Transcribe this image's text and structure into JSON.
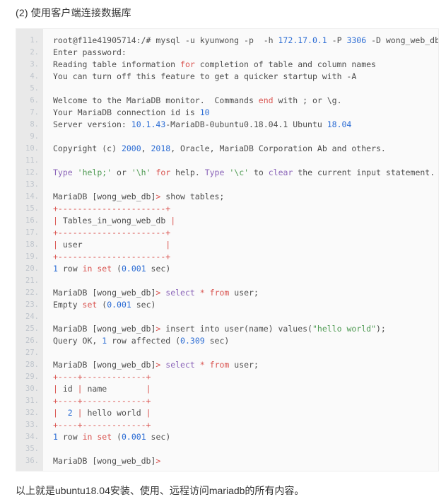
{
  "section": {
    "heading": "(2) 使用客户端连接数据库"
  },
  "footer": {
    "note": "以上就是ubuntu18.04安装、使用、远程访问mariadb的所有内容。"
  },
  "code_block": {
    "language": "shell-session",
    "background_color": "#fafafa",
    "gutter_color": "#e9e9e9",
    "line_number_color": "#bfc5cc",
    "token_colors": {
      "plain": "#4d4d4d",
      "number": "#2b6cd4",
      "keyword": "#d9534f",
      "function": "#8a63b8",
      "string": "#4e9a52",
      "punctuation": "#d9534f"
    },
    "line_numbers": [
      "1.",
      "2.",
      "3.",
      "4.",
      "5.",
      "6.",
      "7.",
      "8.",
      "9.",
      "10.",
      "11.",
      "12.",
      "13.",
      "14.",
      "15.",
      "16.",
      "17.",
      "18.",
      "19.",
      "20.",
      "21.",
      "22.",
      "23.",
      "24.",
      "25.",
      "26.",
      "27.",
      "28.",
      "29.",
      "30.",
      "31.",
      "32.",
      "33.",
      "34.",
      "35.",
      "36."
    ],
    "lines": [
      {
        "n": 1,
        "tokens": [
          {
            "t": "root@f11e41905714:/# mysql -u kyunwong -p  -h ",
            "c": "plain"
          },
          {
            "t": "172.17.0.1",
            "c": "number"
          },
          {
            "t": " -P ",
            "c": "plain"
          },
          {
            "t": "3306",
            "c": "number"
          },
          {
            "t": " -D wong_web_db",
            "c": "plain"
          }
        ]
      },
      {
        "n": 2,
        "tokens": [
          {
            "t": "Enter password:",
            "c": "plain"
          }
        ]
      },
      {
        "n": 3,
        "tokens": [
          {
            "t": "Reading table information ",
            "c": "plain"
          },
          {
            "t": "for",
            "c": "keyword"
          },
          {
            "t": " completion of table and column names",
            "c": "plain"
          }
        ]
      },
      {
        "n": 4,
        "tokens": [
          {
            "t": "You can turn off this feature to get a quicker startup with -A",
            "c": "plain"
          }
        ]
      },
      {
        "n": 5,
        "tokens": [
          {
            "t": "",
            "c": "plain"
          }
        ]
      },
      {
        "n": 6,
        "tokens": [
          {
            "t": "Welcome to the MariaDB monitor.  Commands ",
            "c": "plain"
          },
          {
            "t": "end",
            "c": "keyword"
          },
          {
            "t": " with ; or \\g.",
            "c": "plain"
          }
        ]
      },
      {
        "n": 7,
        "tokens": [
          {
            "t": "Your MariaDB connection id is ",
            "c": "plain"
          },
          {
            "t": "10",
            "c": "number"
          }
        ]
      },
      {
        "n": 8,
        "tokens": [
          {
            "t": "Server version: ",
            "c": "plain"
          },
          {
            "t": "10.1.43",
            "c": "number"
          },
          {
            "t": "-MariaDB-0ubuntu0.18.04.1 Ubuntu ",
            "c": "plain"
          },
          {
            "t": "18.04",
            "c": "number"
          }
        ]
      },
      {
        "n": 9,
        "tokens": [
          {
            "t": "",
            "c": "plain"
          }
        ]
      },
      {
        "n": 10,
        "tokens": [
          {
            "t": "Copyright (c) ",
            "c": "plain"
          },
          {
            "t": "2000",
            "c": "number"
          },
          {
            "t": ", ",
            "c": "plain"
          },
          {
            "t": "2018",
            "c": "number"
          },
          {
            "t": ", Oracle, MariaDB Corporation Ab and others.",
            "c": "plain"
          }
        ]
      },
      {
        "n": 11,
        "tokens": [
          {
            "t": "",
            "c": "plain"
          }
        ]
      },
      {
        "n": 12,
        "tokens": [
          {
            "t": "Type",
            "c": "function"
          },
          {
            "t": " ",
            "c": "plain"
          },
          {
            "t": "'help;'",
            "c": "string"
          },
          {
            "t": " or ",
            "c": "plain"
          },
          {
            "t": "'\\h'",
            "c": "string"
          },
          {
            "t": " ",
            "c": "plain"
          },
          {
            "t": "for",
            "c": "keyword"
          },
          {
            "t": " help. ",
            "c": "plain"
          },
          {
            "t": "Type",
            "c": "function"
          },
          {
            "t": " ",
            "c": "plain"
          },
          {
            "t": "'\\c'",
            "c": "string"
          },
          {
            "t": " to ",
            "c": "plain"
          },
          {
            "t": "clear",
            "c": "function"
          },
          {
            "t": " the current input statement.",
            "c": "plain"
          }
        ]
      },
      {
        "n": 13,
        "tokens": [
          {
            "t": "",
            "c": "plain"
          }
        ]
      },
      {
        "n": 14,
        "tokens": [
          {
            "t": "MariaDB [wong_web_db]",
            "c": "plain"
          },
          {
            "t": "&gt;",
            "c": "punctuation"
          },
          {
            "t": " show tables;",
            "c": "plain"
          }
        ]
      },
      {
        "n": 15,
        "tokens": [
          {
            "t": "+----------------------+",
            "c": "punctuation"
          }
        ]
      },
      {
        "n": 16,
        "tokens": [
          {
            "t": "|",
            "c": "punctuation"
          },
          {
            "t": " Tables_in_wong_web_db ",
            "c": "plain"
          },
          {
            "t": "|",
            "c": "punctuation"
          }
        ]
      },
      {
        "n": 17,
        "tokens": [
          {
            "t": "+----------------------+",
            "c": "punctuation"
          }
        ]
      },
      {
        "n": 18,
        "tokens": [
          {
            "t": "|",
            "c": "punctuation"
          },
          {
            "t": " user                 ",
            "c": "plain"
          },
          {
            "t": "|",
            "c": "punctuation"
          }
        ]
      },
      {
        "n": 19,
        "tokens": [
          {
            "t": "+----------------------+",
            "c": "punctuation"
          }
        ]
      },
      {
        "n": 20,
        "tokens": [
          {
            "t": "1",
            "c": "number"
          },
          {
            "t": " row ",
            "c": "plain"
          },
          {
            "t": "in",
            "c": "keyword"
          },
          {
            "t": " ",
            "c": "plain"
          },
          {
            "t": "set",
            "c": "keyword"
          },
          {
            "t": " (",
            "c": "plain"
          },
          {
            "t": "0.001",
            "c": "number"
          },
          {
            "t": " sec)",
            "c": "plain"
          }
        ]
      },
      {
        "n": 21,
        "tokens": [
          {
            "t": "",
            "c": "plain"
          }
        ]
      },
      {
        "n": 22,
        "tokens": [
          {
            "t": "MariaDB [wong_web_db]",
            "c": "plain"
          },
          {
            "t": "&gt;",
            "c": "punctuation"
          },
          {
            "t": " ",
            "c": "plain"
          },
          {
            "t": "select",
            "c": "function"
          },
          {
            "t": " ",
            "c": "plain"
          },
          {
            "t": "*",
            "c": "punctuation"
          },
          {
            "t": " ",
            "c": "plain"
          },
          {
            "t": "from",
            "c": "keyword"
          },
          {
            "t": " user;",
            "c": "plain"
          }
        ]
      },
      {
        "n": 23,
        "tokens": [
          {
            "t": "Empty ",
            "c": "plain"
          },
          {
            "t": "set",
            "c": "keyword"
          },
          {
            "t": " (",
            "c": "plain"
          },
          {
            "t": "0.001",
            "c": "number"
          },
          {
            "t": " sec)",
            "c": "plain"
          }
        ]
      },
      {
        "n": 24,
        "tokens": [
          {
            "t": "",
            "c": "plain"
          }
        ]
      },
      {
        "n": 25,
        "tokens": [
          {
            "t": "MariaDB [wong_web_db]",
            "c": "plain"
          },
          {
            "t": "&gt;",
            "c": "punctuation"
          },
          {
            "t": " insert into user(name) values(",
            "c": "plain"
          },
          {
            "t": "\"hello world\"",
            "c": "string"
          },
          {
            "t": ");",
            "c": "plain"
          }
        ]
      },
      {
        "n": 26,
        "tokens": [
          {
            "t": "Query OK, ",
            "c": "plain"
          },
          {
            "t": "1",
            "c": "number"
          },
          {
            "t": " row affected (",
            "c": "plain"
          },
          {
            "t": "0.309",
            "c": "number"
          },
          {
            "t": " sec)",
            "c": "plain"
          }
        ]
      },
      {
        "n": 27,
        "tokens": [
          {
            "t": "",
            "c": "plain"
          }
        ]
      },
      {
        "n": 28,
        "tokens": [
          {
            "t": "MariaDB [wong_web_db]",
            "c": "plain"
          },
          {
            "t": "&gt;",
            "c": "punctuation"
          },
          {
            "t": " ",
            "c": "plain"
          },
          {
            "t": "select",
            "c": "function"
          },
          {
            "t": " ",
            "c": "plain"
          },
          {
            "t": "*",
            "c": "punctuation"
          },
          {
            "t": " ",
            "c": "plain"
          },
          {
            "t": "from",
            "c": "keyword"
          },
          {
            "t": " user;",
            "c": "plain"
          }
        ]
      },
      {
        "n": 29,
        "tokens": [
          {
            "t": "+----+-------------+",
            "c": "punctuation"
          }
        ]
      },
      {
        "n": 30,
        "tokens": [
          {
            "t": "|",
            "c": "punctuation"
          },
          {
            "t": " id ",
            "c": "plain"
          },
          {
            "t": "|",
            "c": "punctuation"
          },
          {
            "t": " name        ",
            "c": "plain"
          },
          {
            "t": "|",
            "c": "punctuation"
          }
        ]
      },
      {
        "n": 31,
        "tokens": [
          {
            "t": "+----+-------------+",
            "c": "punctuation"
          }
        ]
      },
      {
        "n": 32,
        "tokens": [
          {
            "t": "|",
            "c": "punctuation"
          },
          {
            "t": "  ",
            "c": "plain"
          },
          {
            "t": "2",
            "c": "number"
          },
          {
            "t": " ",
            "c": "plain"
          },
          {
            "t": "|",
            "c": "punctuation"
          },
          {
            "t": " hello world ",
            "c": "plain"
          },
          {
            "t": "|",
            "c": "punctuation"
          }
        ]
      },
      {
        "n": 33,
        "tokens": [
          {
            "t": "+----+-------------+",
            "c": "punctuation"
          }
        ]
      },
      {
        "n": 34,
        "tokens": [
          {
            "t": "1",
            "c": "number"
          },
          {
            "t": " row ",
            "c": "plain"
          },
          {
            "t": "in",
            "c": "keyword"
          },
          {
            "t": " ",
            "c": "plain"
          },
          {
            "t": "set",
            "c": "keyword"
          },
          {
            "t": " (",
            "c": "plain"
          },
          {
            "t": "0.001",
            "c": "number"
          },
          {
            "t": " sec)",
            "c": "plain"
          }
        ]
      },
      {
        "n": 35,
        "tokens": [
          {
            "t": "",
            "c": "plain"
          }
        ]
      },
      {
        "n": 36,
        "tokens": [
          {
            "t": "MariaDB [wong_web_db]",
            "c": "plain"
          },
          {
            "t": "&gt;",
            "c": "punctuation"
          }
        ]
      }
    ]
  }
}
